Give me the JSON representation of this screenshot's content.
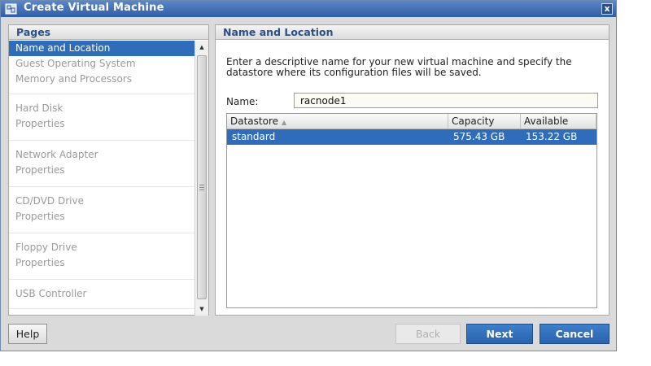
{
  "window": {
    "title": "Create Virtual Machine",
    "close_glyph": "x",
    "app_icon": "vm-window-icon",
    "close_icon": "close-icon"
  },
  "pages_panel": {
    "header": "Pages",
    "items": [
      {
        "label": "Name and Location",
        "active": true
      },
      {
        "label": "Guest Operating System",
        "active": false
      },
      {
        "label": "Memory and Processors",
        "active": false
      },
      {
        "label": "Hard Disk",
        "active": false
      },
      {
        "label": "Properties",
        "active": false
      },
      {
        "label": "Network Adapter",
        "active": false
      },
      {
        "label": "Properties",
        "active": false
      },
      {
        "label": "CD/DVD Drive",
        "active": false
      },
      {
        "label": "Properties",
        "active": false
      },
      {
        "label": "Floppy Drive",
        "active": false
      },
      {
        "label": "Properties",
        "active": false
      },
      {
        "label": "USB Controller",
        "active": false
      }
    ]
  },
  "main_panel": {
    "header": "Name and Location",
    "description": "Enter a descriptive name for your new virtual machine and specify the datastore where its configuration files will be saved.",
    "name_label": "Name:",
    "name_value": "racnode1",
    "table": {
      "columns": [
        "Datastore",
        "Capacity",
        "Available"
      ],
      "sort_icon": "sort-ascending-icon",
      "rows": [
        {
          "datastore": "standard",
          "capacity": "575.43 GB",
          "available": "153.22 GB",
          "selected": true
        }
      ]
    }
  },
  "footer": {
    "help": "Help",
    "back": "Back",
    "next": "Next",
    "cancel": "Cancel"
  },
  "colors": {
    "title_bar": "#2f5ea7",
    "selection": "#2f6dbb",
    "header_text": "#2b4f86",
    "primary_button": "#2a62ad"
  }
}
